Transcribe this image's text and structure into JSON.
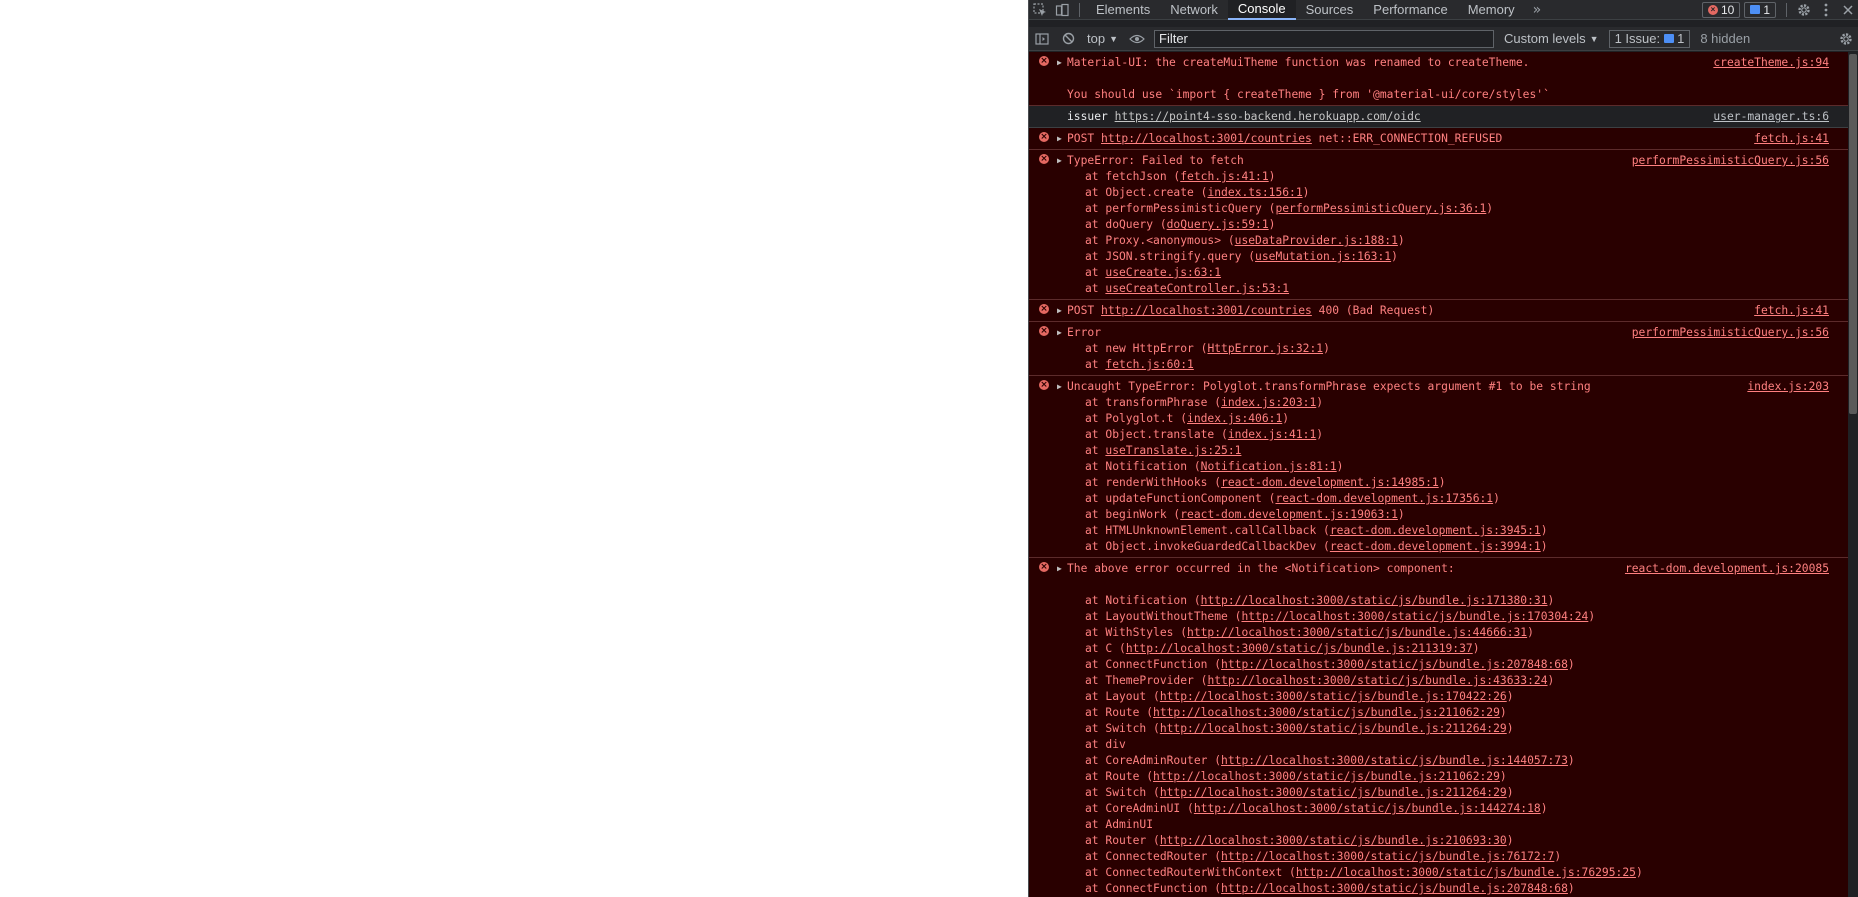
{
  "devtools": {
    "tabs": [
      "Elements",
      "Network",
      "Console",
      "Sources",
      "Performance",
      "Memory"
    ],
    "more_tabs": "»",
    "error_count": "10",
    "message_count": "1"
  },
  "console_toolbar": {
    "context": "top",
    "filter_placeholder": "Filter",
    "levels": "Custom levels",
    "issue_label": "1 Issue:",
    "issue_count": "1",
    "hidden": "8 hidden"
  },
  "entries": [
    {
      "type": "error",
      "source": "createTheme.js:94",
      "lines": [
        "Material-UI: the createMuiTheme function was renamed to createTheme.",
        "",
        "You should use `import { createTheme } from '@material-ui/core/styles'`"
      ]
    },
    {
      "type": "info",
      "label": "issuer",
      "url": "https://point4-sso-backend.herokuapp.com/oidc",
      "source": "user-manager.ts:6"
    },
    {
      "type": "error",
      "prefix": "POST ",
      "url": "http://localhost:3001/countries",
      "suffix": " net::ERR_CONNECTION_REFUSED",
      "source": "fetch.js:41"
    },
    {
      "type": "error",
      "head": "TypeError: Failed to fetch",
      "source": "performPessimisticQuery.js:56",
      "frames": [
        [
          "fetchJson",
          "fetch.js:41:1"
        ],
        [
          "Object.create",
          "index.ts:156:1"
        ],
        [
          "performPessimisticQuery",
          "performPessimisticQuery.js:36:1"
        ],
        [
          "doQuery",
          "doQuery.js:59:1"
        ],
        [
          "Proxy.<anonymous>",
          "useDataProvider.js:188:1"
        ],
        [
          "JSON.stringify.query",
          "useMutation.js:163:1"
        ],
        [
          "",
          "useCreate.js:63:1"
        ],
        [
          "",
          "useCreateController.js:53:1"
        ]
      ]
    },
    {
      "type": "error",
      "prefix": "POST ",
      "url": "http://localhost:3001/countries",
      "suffix": " 400 (Bad Request)",
      "source": "fetch.js:41"
    },
    {
      "type": "error",
      "head": "Error",
      "source": "performPessimisticQuery.js:56",
      "frames": [
        [
          "new HttpError",
          "HttpError.js:32:1"
        ],
        [
          "",
          "fetch.js:60:1"
        ]
      ]
    },
    {
      "type": "error",
      "head": "Uncaught TypeError: Polyglot.transformPhrase expects argument #1 to be string",
      "source": "index.js:203",
      "frames": [
        [
          "transformPhrase",
          "index.js:203:1"
        ],
        [
          "Polyglot.t",
          "index.js:406:1"
        ],
        [
          "Object.translate",
          "index.js:41:1"
        ],
        [
          "",
          "useTranslate.js:25:1"
        ],
        [
          "Notification",
          "Notification.js:81:1"
        ],
        [
          "renderWithHooks",
          "react-dom.development.js:14985:1"
        ],
        [
          "updateFunctionComponent",
          "react-dom.development.js:17356:1"
        ],
        [
          "beginWork",
          "react-dom.development.js:19063:1"
        ],
        [
          "HTMLUnknownElement.callCallback",
          "react-dom.development.js:3945:1"
        ],
        [
          "Object.invokeGuardedCallbackDev",
          "react-dom.development.js:3994:1"
        ]
      ]
    },
    {
      "type": "error",
      "head": "The above error occurred in the <Notification> component:",
      "source": "react-dom.development.js:20085",
      "blank_after_head": true,
      "frames": [
        [
          "Notification",
          "http://localhost:3000/static/js/bundle.js:171380:31"
        ],
        [
          "LayoutWithoutTheme",
          "http://localhost:3000/static/js/bundle.js:170304:24"
        ],
        [
          "WithStyles",
          "http://localhost:3000/static/js/bundle.js:44666:31"
        ],
        [
          "C",
          "http://localhost:3000/static/js/bundle.js:211319:37"
        ],
        [
          "ConnectFunction",
          "http://localhost:3000/static/js/bundle.js:207848:68"
        ],
        [
          "ThemeProvider",
          "http://localhost:3000/static/js/bundle.js:43633:24"
        ],
        [
          "Layout",
          "http://localhost:3000/static/js/bundle.js:170422:26"
        ],
        [
          "Route",
          "http://localhost:3000/static/js/bundle.js:211062:29"
        ],
        [
          "Switch",
          "http://localhost:3000/static/js/bundle.js:211264:29"
        ],
        [
          "div",
          ""
        ],
        [
          "CoreAdminRouter",
          "http://localhost:3000/static/js/bundle.js:144057:73"
        ],
        [
          "Route",
          "http://localhost:3000/static/js/bundle.js:211062:29"
        ],
        [
          "Switch",
          "http://localhost:3000/static/js/bundle.js:211264:29"
        ],
        [
          "CoreAdminUI",
          "http://localhost:3000/static/js/bundle.js:144274:18"
        ],
        [
          "AdminUI",
          ""
        ],
        [
          "Router",
          "http://localhost:3000/static/js/bundle.js:210693:30"
        ],
        [
          "ConnectedRouter",
          "http://localhost:3000/static/js/bundle.js:76172:7"
        ],
        [
          "ConnectedRouterWithContext",
          "http://localhost:3000/static/js/bundle.js:76295:25"
        ],
        [
          "ConnectFunction",
          "http://localhost:3000/static/js/bundle.js:207848:68"
        ]
      ]
    }
  ]
}
